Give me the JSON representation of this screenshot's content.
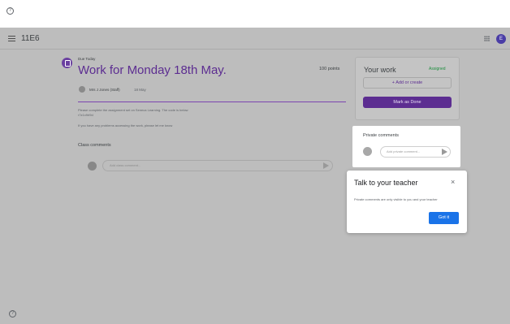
{
  "icons": {
    "help": "help-circle-icon",
    "menu": "hamburger-menu-icon",
    "apps": "apps-grid-icon",
    "assignment": "assignment-icon",
    "send": "send-icon",
    "close": "close-icon"
  },
  "help_glyph": "?",
  "header": {
    "class_name": "11E6",
    "avatar_letter": "E"
  },
  "assignment": {
    "due": "Due Today",
    "title": "Work for Monday 18th May.",
    "points": "100 points",
    "teacher": "Mrs J Jones (Staff)",
    "date": "18 May",
    "instruction_1": "Please complete the assignment set on Seneca Learning. The code is below",
    "instruction_2": "r7z1x9rl9d",
    "instruction_3": "If you have any problems accessing the work, please let me know"
  },
  "class_comments": {
    "label": "Class comments",
    "placeholder": "Add class comment..."
  },
  "your_work": {
    "title": "Your work",
    "status": "Assigned",
    "add_button": "+ Add or create",
    "done_button": "Mark as Done"
  },
  "private_comments": {
    "title": "Private comments",
    "placeholder": "Add private comment..."
  },
  "popup": {
    "title": "Talk to your teacher",
    "close_glyph": "×",
    "body": "Private comments are only visible to you and your teacher",
    "button": "Got it"
  },
  "colors": {
    "accent": "#5c2d91",
    "status_green": "#1e8e3e",
    "button_blue": "#1a73e8",
    "overlay": "#bdbdbd"
  }
}
